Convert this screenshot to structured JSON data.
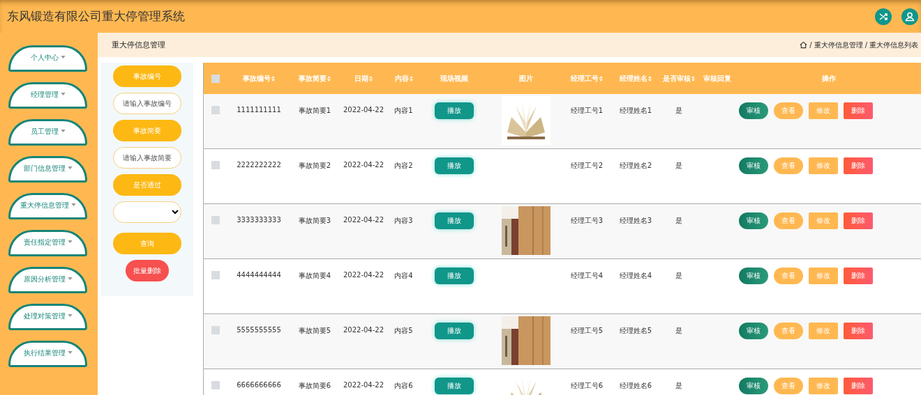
{
  "header": {
    "title": "东风锻造有限公司重大停管理系统"
  },
  "sidebar": {
    "items": [
      {
        "label": "个人中心"
      },
      {
        "label": "经理管理"
      },
      {
        "label": "员工管理"
      },
      {
        "label": "部门信息管理"
      },
      {
        "label": "重大停信息管理"
      },
      {
        "label": "责任指定管理"
      },
      {
        "label": "原因分析管理"
      },
      {
        "label": "处理对策管理"
      },
      {
        "label": "执行结果管理"
      }
    ]
  },
  "page_title": "重大停信息管理",
  "breadcrumb": [
    {
      "separator": "/",
      "label": "重大停信息管理"
    },
    {
      "separator": "/",
      "label": "重大停信息列表"
    }
  ],
  "search": {
    "fields": [
      {
        "label": "事故编号",
        "kind": "input",
        "placeholder": "请输入事故编号"
      },
      {
        "label": "事故简要",
        "kind": "input",
        "placeholder": "请输入事故简要"
      },
      {
        "label": "是否通过",
        "kind": "select"
      }
    ],
    "query_button": "查询",
    "batch_delete_button": "批量删除"
  },
  "table": {
    "select_all_checked": false,
    "columns": [
      {
        "label": "事故编号",
        "sortable": true
      },
      {
        "label": "事故简要",
        "sortable": true
      },
      {
        "label": "日期",
        "sortable": true
      },
      {
        "label": "内容",
        "sortable": true
      },
      {
        "label": "现场视频",
        "sortable": false
      },
      {
        "label": "图片",
        "sortable": false
      },
      {
        "label": "经理工号",
        "sortable": true
      },
      {
        "label": "经理姓名",
        "sortable": true
      },
      {
        "label": "是否审核",
        "sortable": true
      },
      {
        "label": "审核回复",
        "sortable": false
      },
      {
        "label": "操作",
        "sortable": false
      }
    ],
    "rows": [
      {
        "checked": false,
        "id": "1111111111",
        "summary": "事故简要1",
        "date": "2022-04-22",
        "content": "内容1",
        "video_button": "播放",
        "has_picture": true,
        "manager_no": "经理工号1",
        "manager_name": "经理姓名1",
        "reviewed": "是",
        "actions": [
          "审核",
          "查看",
          "修改",
          "删除"
        ]
      },
      {
        "checked": false,
        "id": "2222222222",
        "summary": "事故简要2",
        "date": "2022-04-22",
        "content": "内容2",
        "video_button": "播放",
        "has_picture": false,
        "manager_no": "经理工号2",
        "manager_name": "经理姓名2",
        "reviewed": "是",
        "actions": [
          "审核",
          "查看",
          "修改",
          "删除"
        ]
      },
      {
        "checked": false,
        "id": "3333333333",
        "summary": "事故简要3",
        "date": "2022-04-22",
        "content": "内容3",
        "video_button": "播放",
        "has_picture": true,
        "manager_no": "经理工号3",
        "manager_name": "经理姓名3",
        "reviewed": "是",
        "actions": [
          "审核",
          "查看",
          "修改",
          "删除"
        ]
      },
      {
        "checked": false,
        "id": "4444444444",
        "summary": "事故简要4",
        "date": "2022-04-22",
        "content": "内容4",
        "video_button": "播放",
        "has_picture": false,
        "manager_no": "经理工号4",
        "manager_name": "经理姓名4",
        "reviewed": "是",
        "actions": [
          "审核",
          "查看",
          "修改",
          "删除"
        ]
      },
      {
        "checked": false,
        "id": "5555555555",
        "summary": "事故简要5",
        "date": "2022-04-22",
        "content": "内容5",
        "video_button": "播放",
        "has_picture": true,
        "manager_no": "经理工号5",
        "manager_name": "经理姓名5",
        "reviewed": "是",
        "actions": [
          "审核",
          "查看",
          "修改",
          "删除"
        ]
      },
      {
        "checked": false,
        "id": "6666666666",
        "summary": "事故简要6",
        "date": "2022-04-22",
        "content": "内容6",
        "video_button": "播放",
        "has_picture": true,
        "manager_no": "经理工号6",
        "manager_name": "经理姓名6",
        "reviewed": "是",
        "actions": [
          "审核",
          "查看",
          "修改",
          "删除"
        ]
      }
    ]
  }
}
